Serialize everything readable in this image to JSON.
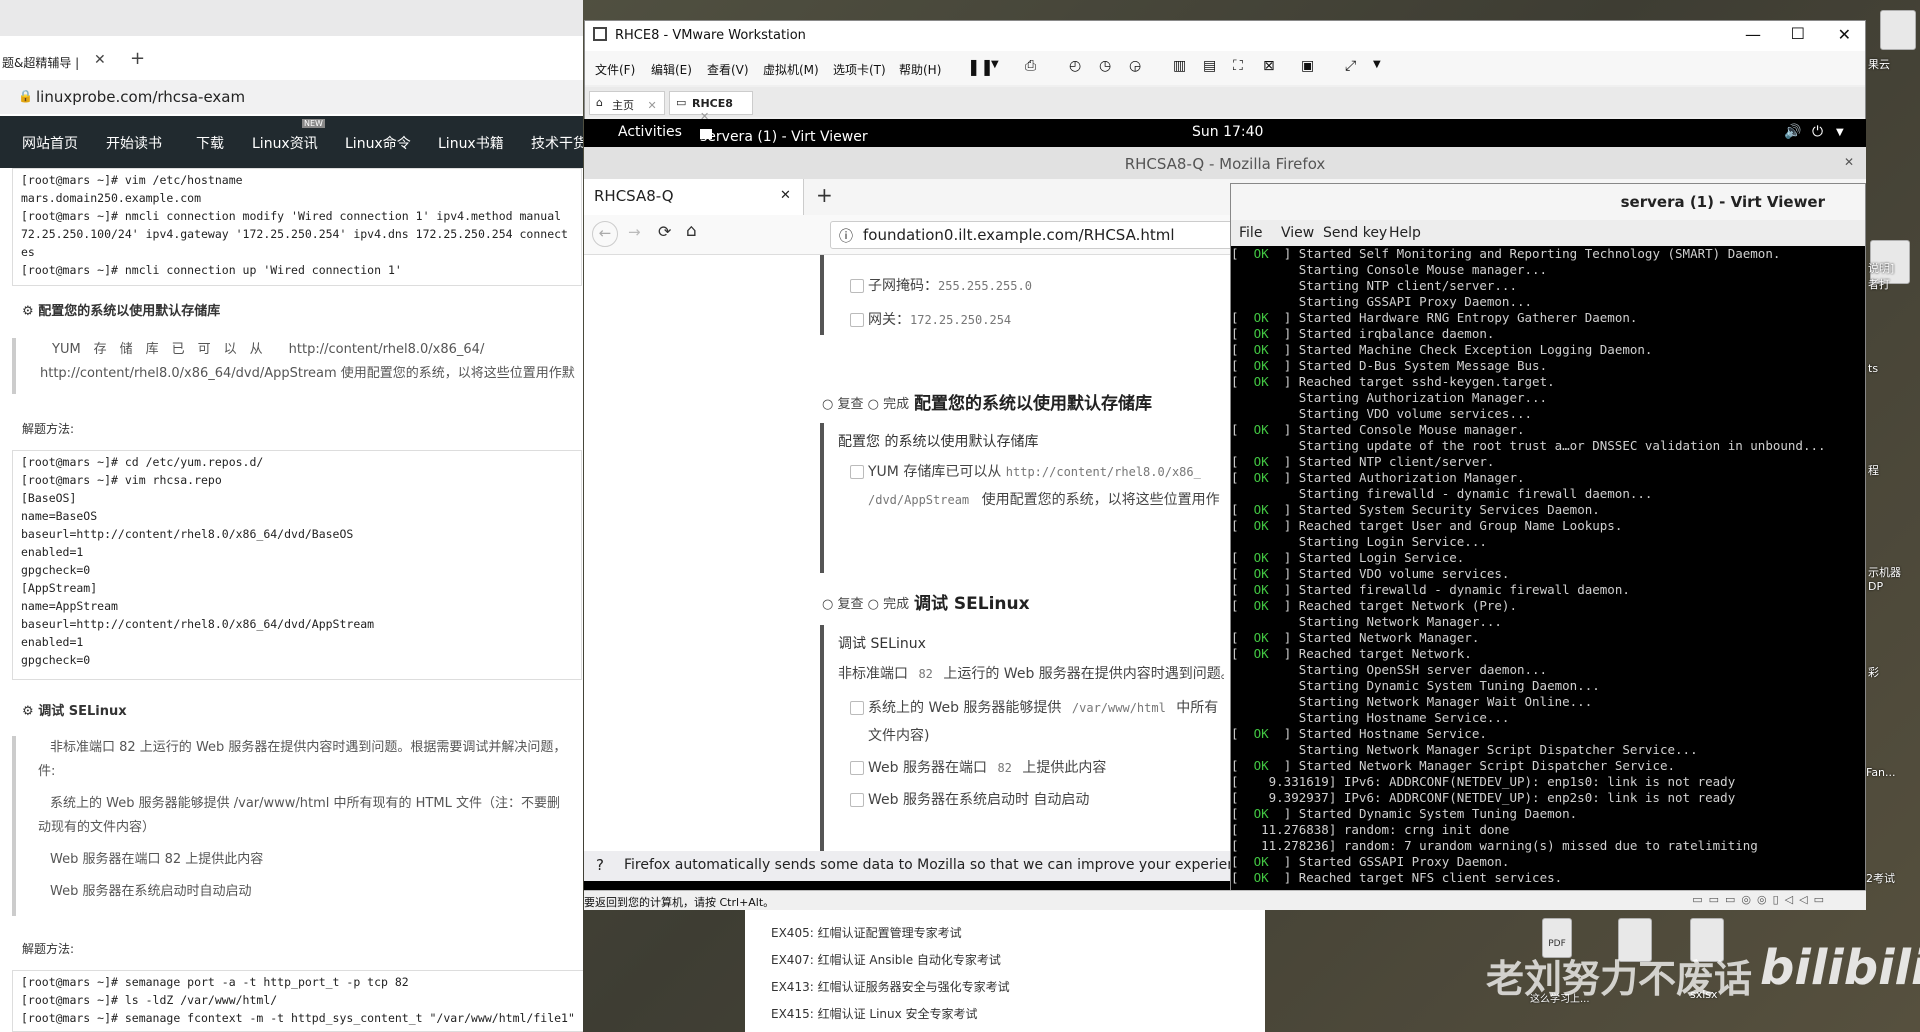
{
  "left_browser": {
    "tab_title": "题&超精辅导 |",
    "address": "linuxprobe.com/rhcsa-exam",
    "nav": [
      "网站首页",
      "开始读书",
      "下载",
      "Linux资讯",
      "Linux命令",
      "Linux书籍",
      "技术干货"
    ],
    "nav_badge": "NEW",
    "code1": "[root@mars ~]# vim /etc/hostname\nmars.domain250.example.com\n[root@mars ~]# nmcli connection modify 'Wired connection 1' ipv4.method manual\n72.25.250.100/24' ipv4.gateway '172.25.250.254' ipv4.dns 172.25.250.254 connect\nes\n[root@mars ~]# nmcli connection up 'Wired connection 1'",
    "sec1_title": "配置您的系统以使用默认存储库",
    "sec1_text1": "YUM　存　储　库　已　可　以　从　　http://content/rhel8.0/x86_64/",
    "sec1_text2": "http://content/rhel8.0/x86_64/dvd/AppStream 使用配置您的系统，以将这些位置用作默",
    "solution1": "解题方法:",
    "code2": "[root@mars ~]# cd /etc/yum.repos.d/\n[root@mars ~]# vim rhcsa.repo\n[BaseOS]\nname=BaseOS\nbaseurl=http://content/rhel8.0/x86_64/dvd/BaseOS\nenabled=1\ngpgcheck=0\n[AppStream]\nname=AppStream\nbaseurl=http://content/rhel8.0/x86_64/dvd/AppStream\nenabled=1\ngpgcheck=0",
    "sec2_title": "调试 SELinux",
    "sec2_p1": "非标准端口 82 上运行的 Web 服务器在提供内容时遇到问题。根据需要调试并解决问题，",
    "sec2_p1b": "件:",
    "sec2_p2": "系统上的 Web 服务器能够提供 /var/www/html 中所有现有的 HTML 文件（注：不要删",
    "sec2_p2b": "动现有的文件内容）",
    "sec2_p3": "Web 服务器在端口 82 上提供此内容",
    "sec2_p4": "Web 服务器在系统启动时自动启动",
    "solution2": "解题方法:",
    "code3": "[root@mars ~]# semanage port -a -t http_port_t -p tcp 82\n[root@mars ~]# ls -ldZ /var/www/html/\n[root@mars ~]# semanage fcontext -m -t httpd_sys_content_t \"/var/www/html/file1\""
  },
  "vmware": {
    "title": "RHCE8 - VMware Workstation",
    "menu": [
      "文件(F)",
      "编辑(E)",
      "查看(V)",
      "虚拟机(M)",
      "选项卡(T)",
      "帮助(H)"
    ],
    "tabs": [
      "主页",
      "RHCE8"
    ],
    "status": "要返回到您的计算机，请按 Ctrl+Alt。"
  },
  "gnome": {
    "activities": "Activities",
    "app": "servera (1) - Virt Viewer",
    "clock": "Sun 17:40"
  },
  "firefox": {
    "window_title": "RHCSA8-Q - Mozilla Firefox",
    "tab": "RHCSA8-Q",
    "url": "foundation0.ilt.example.com/RHCSA.html",
    "subnet_label": "子网掩码：",
    "subnet_value": "255.255.255.0",
    "gateway_label": "网关：",
    "gateway_value": "172.25.250.254",
    "sec1_prefix": "○ 复查 ○ 完成",
    "sec1_title": "配置您的系统以使用默认存储库",
    "sec1_sub": "配置您 的系统以使用默认存储库",
    "sec1_item": "YUM 存储库已可以从",
    "sec1_item_url": "http://content/rhel8.0/x86_",
    "sec1_item2_url": "/dvd/AppStream",
    "sec1_item2_text": "使用配置您的系统，以将这些位置用作",
    "sec2_prefix": "○ 复查 ○ 完成",
    "sec2_title": "调试 SELinux",
    "sec2_sub": "调试 SELinux",
    "sec2_p1a": "非标准端口",
    "sec2_p1port": "82",
    "sec2_p1b": "上运行的 Web 服务器在提供内容时遇到问题。",
    "sec2_c1": "系统上的 Web 服务器能够提供",
    "sec2_c1path": "/var/www/html",
    "sec2_c1b": "中所有",
    "sec2_c1c": "文件内容)",
    "sec2_c2a": "Web 服务器在端口",
    "sec2_c2port": "82",
    "sec2_c2b": "上提供此内容",
    "sec2_c3": "Web 服务器在系统启动时 自动启动",
    "notice": "Firefox automatically sends some data to Mozilla so that we can improve your experience."
  },
  "virt_viewer": {
    "title": "servera (1) - Virt Viewer",
    "menu": [
      "File",
      "View",
      "Send key",
      "Help"
    ],
    "console": [
      [
        "OK",
        "Started Self Monitoring and Reporting Technology (SMART) Daemon."
      ],
      [
        "",
        "Starting Console Mouse manager..."
      ],
      [
        "",
        "Starting NTP client/server..."
      ],
      [
        "",
        "Starting GSSAPI Proxy Daemon..."
      ],
      [
        "OK",
        "Started Hardware RNG Entropy Gatherer Daemon."
      ],
      [
        "OK",
        "Started irqbalance daemon."
      ],
      [
        "OK",
        "Started Machine Check Exception Logging Daemon."
      ],
      [
        "OK",
        "Started D-Bus System Message Bus."
      ],
      [
        "OK",
        "Reached target sshd-keygen.target."
      ],
      [
        "",
        "Starting Authorization Manager..."
      ],
      [
        "",
        "Starting VDO volume services..."
      ],
      [
        "OK",
        "Started Console Mouse manager."
      ],
      [
        "",
        "Starting update of the root trust a…or DNSSEC validation in unbound..."
      ],
      [
        "OK",
        "Started NTP client/server."
      ],
      [
        "OK",
        "Started Authorization Manager."
      ],
      [
        "",
        "Starting firewalld - dynamic firewall daemon..."
      ],
      [
        "OK",
        "Started System Security Services Daemon."
      ],
      [
        "OK",
        "Reached target User and Group Name Lookups."
      ],
      [
        "",
        "Starting Login Service..."
      ],
      [
        "OK",
        "Started Login Service."
      ],
      [
        "OK",
        "Started VDO volume services."
      ],
      [
        "OK",
        "Started firewalld - dynamic firewall daemon."
      ],
      [
        "OK",
        "Reached target Network (Pre)."
      ],
      [
        "",
        "Starting Network Manager..."
      ],
      [
        "OK",
        "Started Network Manager."
      ],
      [
        "OK",
        "Reached target Network."
      ],
      [
        "",
        "Starting OpenSSH server daemon..."
      ],
      [
        "",
        "Starting Dynamic System Tuning Daemon..."
      ],
      [
        "",
        "Starting Network Manager Wait Online..."
      ],
      [
        "",
        "Starting Hostname Service..."
      ],
      [
        "OK",
        "Started Hostname Service."
      ],
      [
        "",
        "Starting Network Manager Script Dispatcher Service..."
      ],
      [
        "OK",
        "Started Network Manager Script Dispatcher Service."
      ],
      [
        "RAW",
        "[    9.331619] IPv6: ADDRCONF(NETDEV_UP): enp1s0: link is not ready"
      ],
      [
        "RAW",
        "[    9.392937] IPv6: ADDRCONF(NETDEV_UP): enp2s0: link is not ready"
      ],
      [
        "OK",
        "Started Dynamic System Tuning Daemon."
      ],
      [
        "RAW",
        "[   11.276838] random: crng init done"
      ],
      [
        "RAW",
        "[   11.278236] random: 7 urandom warning(s) missed due to ratelimiting"
      ],
      [
        "OK",
        "Started GSSAPI Proxy Daemon."
      ],
      [
        "OK",
        "Reached target NFS client services."
      ]
    ]
  },
  "bottom_links": [
    "EX405: 红帽认证配置管理专家考试",
    "EX407: 红帽认证 Ansible 自动化专家考试",
    "EX413: 红帽认证服务器安全与强化专家考试",
    "EX415: 红帽认证 Linux 安全专家考试"
  ],
  "watermark": "老刘努力不废话",
  "watermark_brand": "bilibili",
  "desktop_labels": [
    "果云",
    "说明]",
    "者打",
    "ts",
    "程",
    "示机器",
    "DP",
    "彩",
    "Fan...",
    "2考试",
    "sxlsx",
    "这么学习上...",
    "PDF"
  ]
}
